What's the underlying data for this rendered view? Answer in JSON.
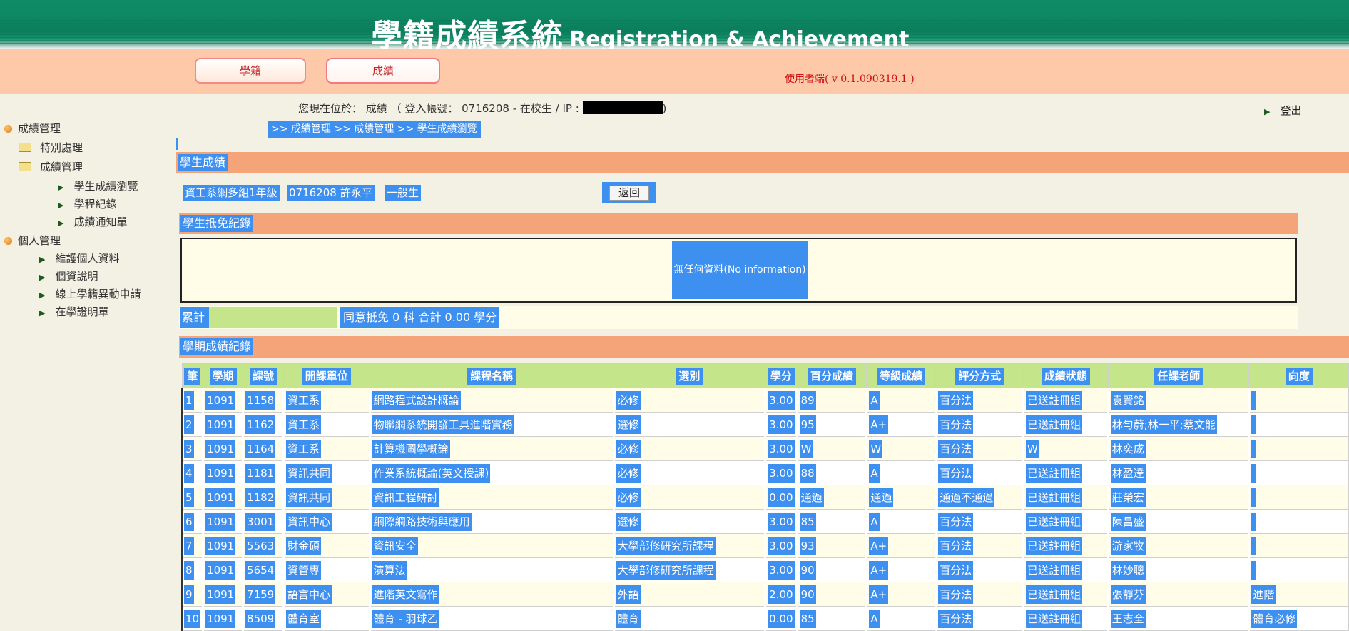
{
  "banner": {
    "title_zh": "學籍成績系統",
    "title_en": "Registration & Achievement"
  },
  "nav": {
    "registration": "學籍",
    "grades": "成績",
    "version": "使用者端( v 0.1.090319.1 )"
  },
  "location": {
    "prefix": "您現在位於：",
    "link": "成績",
    "account_text": "（ 登入帳號： 0716208 - 在校生 / IP :",
    "close": ")"
  },
  "logout": "登出",
  "breadcrumb": ">> 成績管理 >> 成績管理 >> 學生成績瀏覽",
  "sidebar": {
    "grade_mgmt": "成績管理",
    "special": "特別處理",
    "grade_mgmt_folder": "成績管理",
    "browse": "學生成績瀏覽",
    "program": "學程紀錄",
    "notice": "成績通知單",
    "personal_mgmt": "個人管理",
    "maintain": "維護個人資料",
    "privacy": "個資說明",
    "online_change": "線上學籍異動申請",
    "certificate": "在學證明單"
  },
  "student": {
    "section_title": "學生成績",
    "dept": "資工系網多組1年級",
    "id": "0716208",
    "name": "許永平",
    "type": "一般生",
    "back": "返回"
  },
  "exempt": {
    "section_title": "學生抵免紀錄",
    "no_info": "無任何資料(No information)",
    "sum_label": "累計",
    "sum_text": "同意抵免 0 科 合計 0.00 學分"
  },
  "semester": {
    "section_title": "學期成績紀錄",
    "headers": [
      "筆",
      "學期",
      "課號",
      "開課單位",
      "課程名稱",
      "選別",
      "學分",
      "百分成績",
      "等級成績",
      "評分方式",
      "成績狀態",
      "任課老師",
      "向度"
    ],
    "rows": [
      [
        "1",
        "1091",
        "1158",
        "資工系",
        "網路程式設計概論",
        "必修",
        "3.00",
        "89",
        "A",
        "百分法",
        "已送註冊組",
        "袁賢銘",
        ""
      ],
      [
        "2",
        "1091",
        "1162",
        "資工系",
        "物聯網系統開發工具進階實務",
        "選修",
        "3.00",
        "95",
        "A+",
        "百分法",
        "已送註冊組",
        "林勻蔚;林一平;蔡文能",
        ""
      ],
      [
        "3",
        "1091",
        "1164",
        "資工系",
        "計算機圖學概論",
        "必修",
        "3.00",
        "W",
        "W",
        "百分法",
        "W",
        "林奕成",
        ""
      ],
      [
        "4",
        "1091",
        "1181",
        "資訊共同",
        "作業系統概論(英文授課)",
        "必修",
        "3.00",
        "88",
        "A",
        "百分法",
        "已送註冊組",
        "林盈達",
        ""
      ],
      [
        "5",
        "1091",
        "1182",
        "資訊共同",
        "資訊工程研討",
        "必修",
        "0.00",
        "通過",
        "通過",
        "通過不通過",
        "已送註冊組",
        "莊榮宏",
        ""
      ],
      [
        "6",
        "1091",
        "3001",
        "資訊中心",
        "網際網路技術與應用",
        "選修",
        "3.00",
        "85",
        "A",
        "百分法",
        "已送註冊組",
        "陳昌盛",
        ""
      ],
      [
        "7",
        "1091",
        "5563",
        "財金碩",
        "資訊安全",
        "大學部修研究所課程",
        "3.00",
        "93",
        "A+",
        "百分法",
        "已送註冊組",
        "游家牧",
        ""
      ],
      [
        "8",
        "1091",
        "5654",
        "資管專",
        "演算法",
        "大學部修研究所課程",
        "3.00",
        "90",
        "A+",
        "百分法",
        "已送註冊組",
        "林妙聰",
        ""
      ],
      [
        "9",
        "1091",
        "7159",
        "語言中心",
        "進階英文寫作",
        "外語",
        "2.00",
        "90",
        "A+",
        "百分法",
        "已送註冊組",
        "張靜芬",
        "進階"
      ],
      [
        "10",
        "1091",
        "8509",
        "體育室",
        "體育 - 羽球乙",
        "體育",
        "0.00",
        "85",
        "A",
        "百分法",
        "已送註冊組",
        "王志全",
        "體育必修"
      ]
    ]
  }
}
